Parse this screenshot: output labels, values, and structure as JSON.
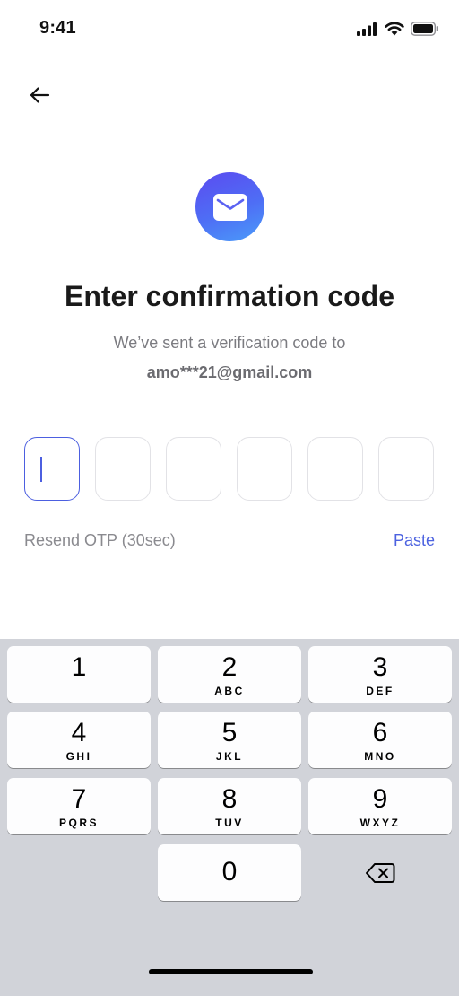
{
  "status_bar": {
    "time": "9:41"
  },
  "title": "Enter confirmation code",
  "subtitle": "We’ve sent a verification code to",
  "email": "amo***21@gmail.com",
  "otp": {
    "length": 6,
    "active_index": 0
  },
  "resend_label": "Resend OTP (30sec)",
  "paste_label": "Paste",
  "colors": {
    "accent": "#4c5fe0",
    "badge_gradient_start": "#5b4bf0",
    "badge_gradient_end": "#4a9cf9",
    "keyboard_bg": "#d1d3d9"
  },
  "keypad": {
    "keys": [
      {
        "num": "1",
        "letters": ""
      },
      {
        "num": "2",
        "letters": "ABC"
      },
      {
        "num": "3",
        "letters": "DEF"
      },
      {
        "num": "4",
        "letters": "GHI"
      },
      {
        "num": "5",
        "letters": "JKL"
      },
      {
        "num": "6",
        "letters": "MNO"
      },
      {
        "num": "7",
        "letters": "PQRS"
      },
      {
        "num": "8",
        "letters": "TUV"
      },
      {
        "num": "9",
        "letters": "WXYZ"
      },
      {
        "num": "0",
        "letters": ""
      }
    ]
  },
  "icons": {
    "back": "arrow-left-icon",
    "mail": "mail-icon",
    "delete": "backspace-icon"
  }
}
